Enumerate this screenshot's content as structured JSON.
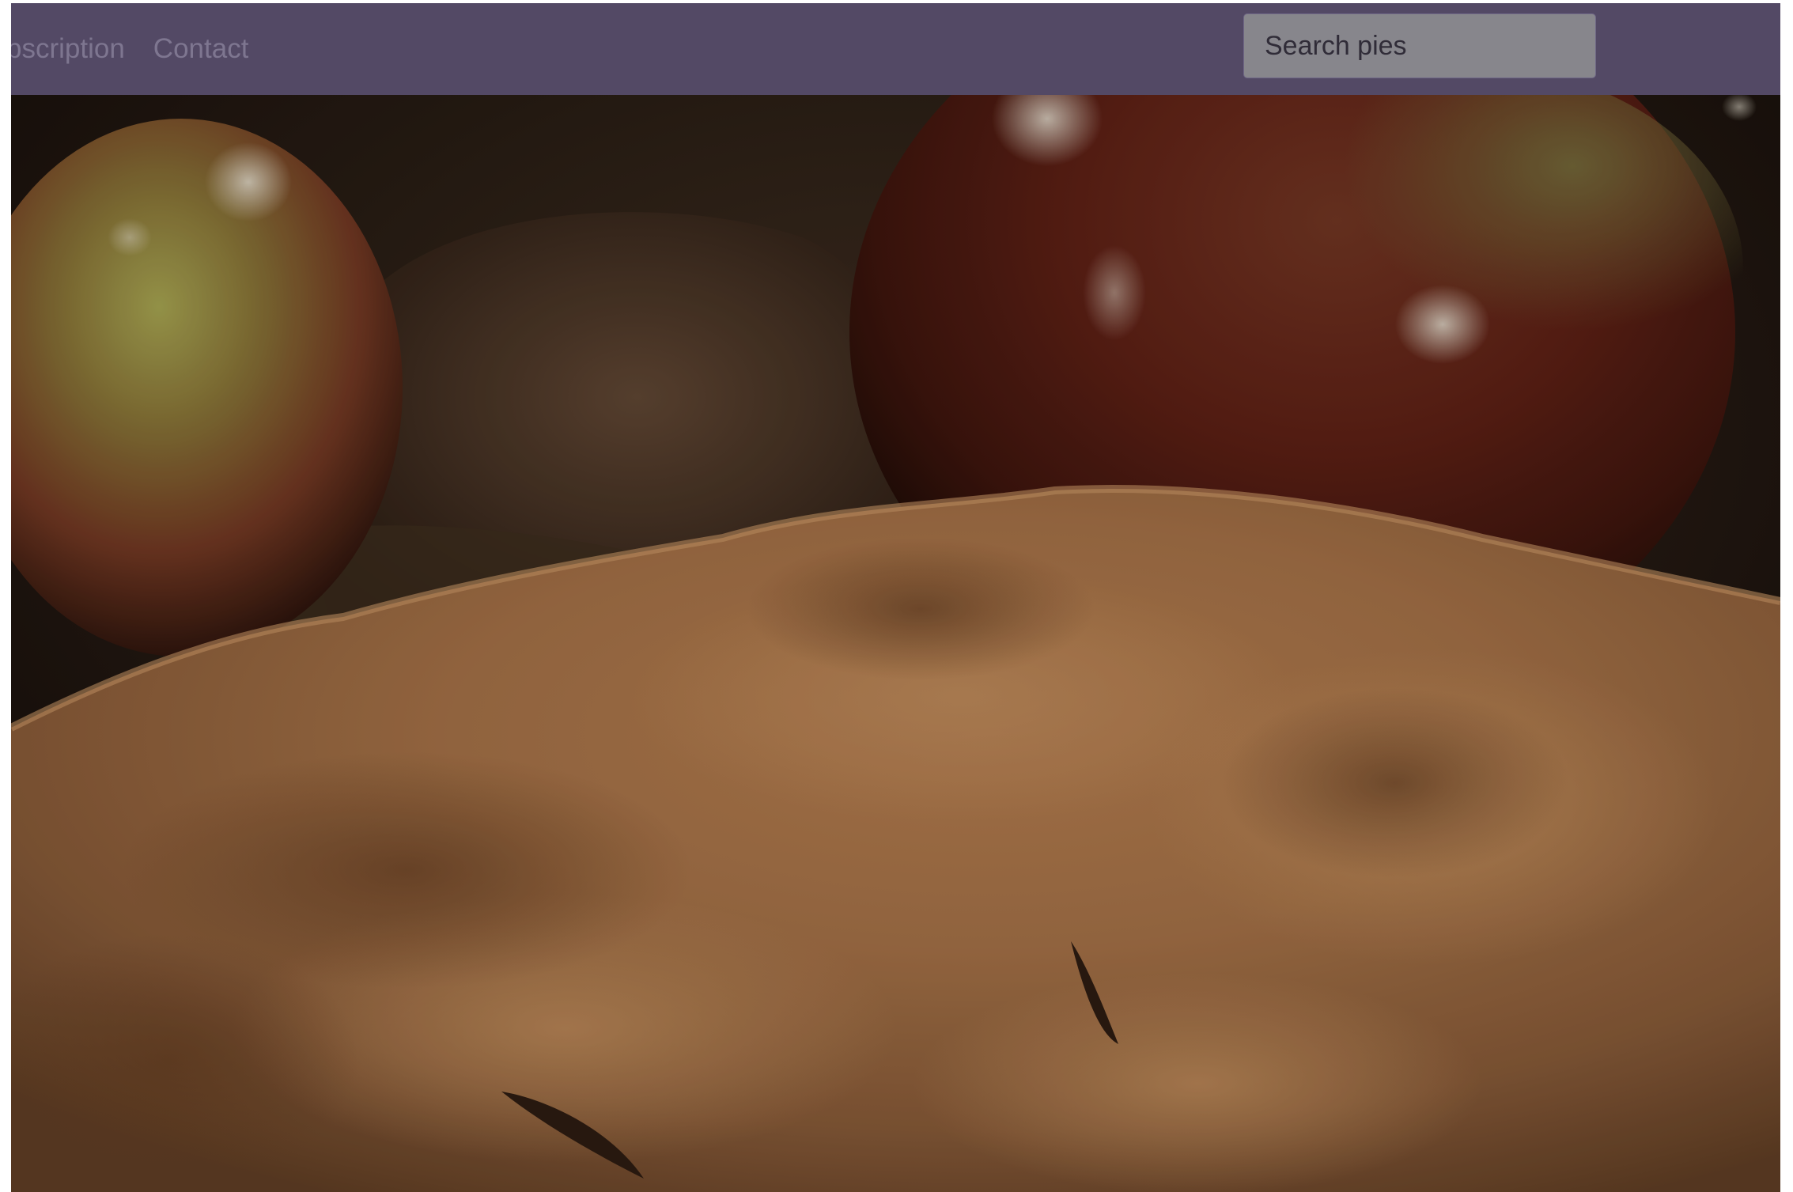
{
  "navbar": {
    "links": [
      {
        "label": "bscription"
      },
      {
        "label": "Contact"
      }
    ],
    "search": {
      "placeholder": "Search pies",
      "value": ""
    },
    "background_color": "#534965"
  },
  "hero": {
    "subject": "apple pie with apples in background"
  }
}
